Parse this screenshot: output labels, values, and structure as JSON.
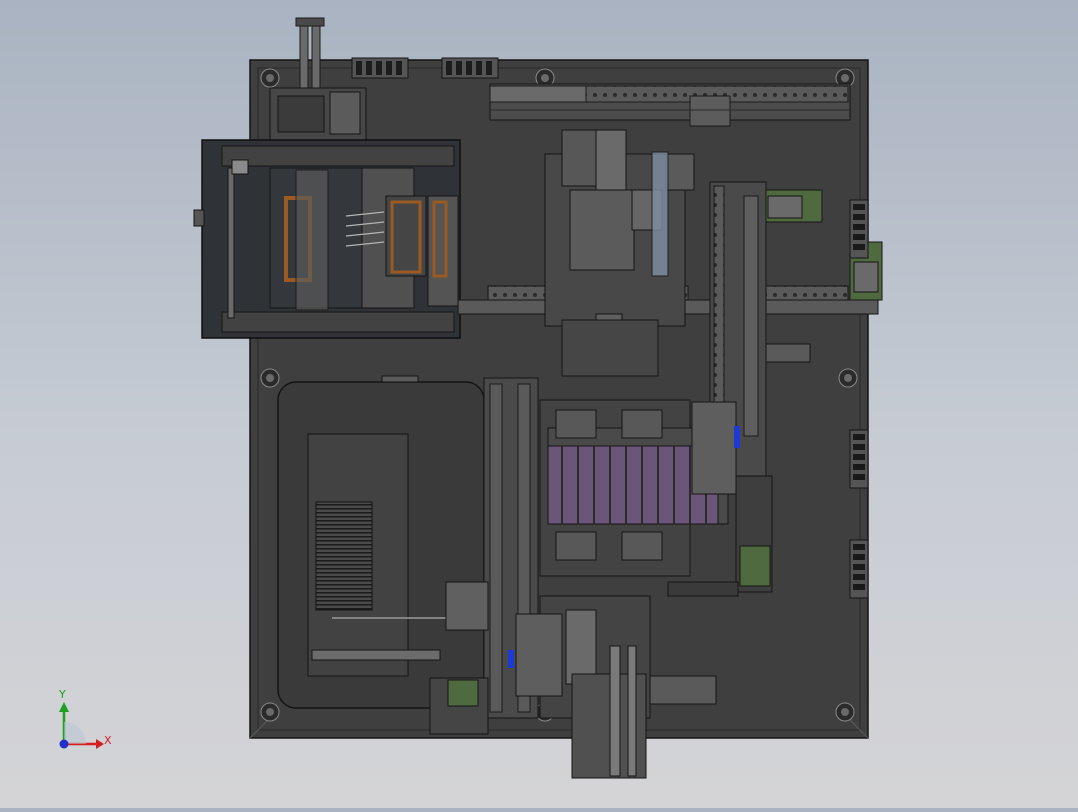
{
  "viewport": {
    "view": "top",
    "background": [
      "#a9b3c1",
      "#d4d4d6"
    ]
  },
  "triad": {
    "x_label": "X",
    "y_label": "Y",
    "x_color": "#d42020",
    "y_color": "#1ea01e",
    "z_color": "#2030c8"
  },
  "model": {
    "base_color": "#3f3f3f",
    "part_color": "#515151",
    "edge_color": "#1a1a1a",
    "highlight_color": "#8a8a8a",
    "accent_purple": "#6b5578",
    "accent_orange": "#9a5a24",
    "accent_green": "#4f6a3f",
    "accent_blue": "#1e3ad6"
  }
}
